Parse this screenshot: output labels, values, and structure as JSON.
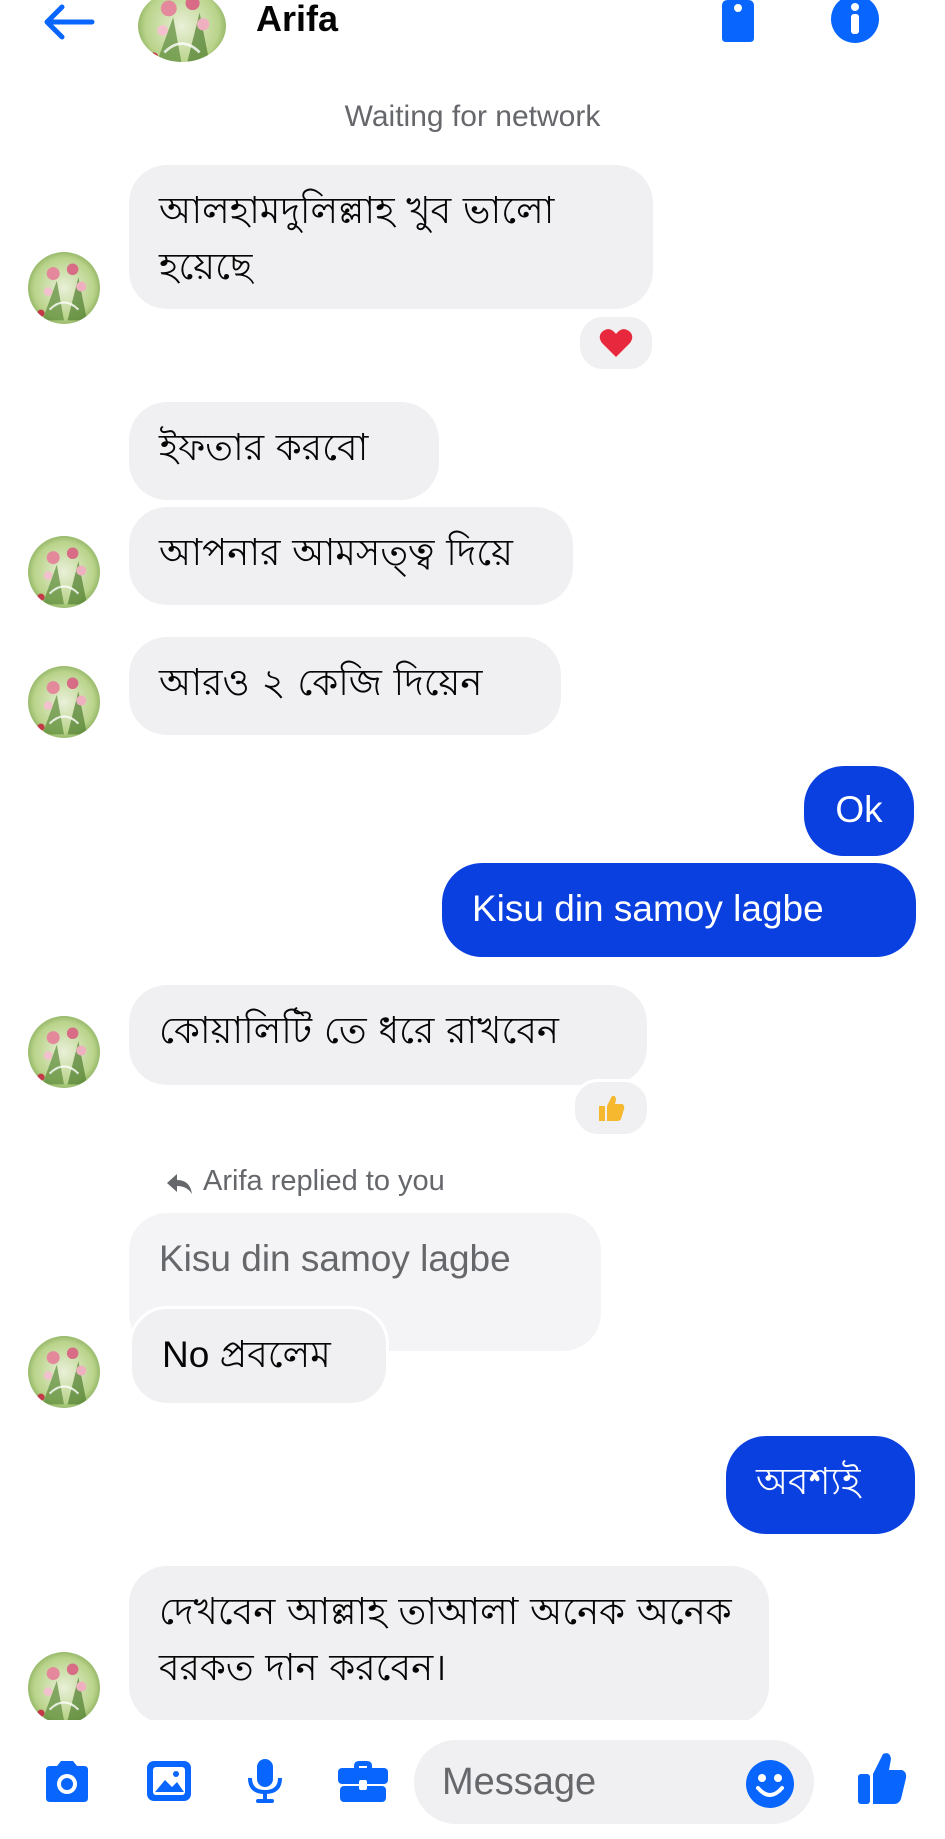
{
  "header": {
    "contact_name": "Arifa",
    "status": "Waiting for network"
  },
  "messages": [
    {
      "text": "আলহামদুলিল্লাহ খুব ভালো হয়েছে",
      "reaction": "heart"
    },
    {
      "text": "ইফতার করবো"
    },
    {
      "text": "আপনার আমসত্ত্ব দিয়ে"
    },
    {
      "text": "আরও ২ কেজি দিয়েন"
    },
    {
      "text": "Ok"
    },
    {
      "text": "Kisu din samoy lagbe"
    },
    {
      "text": "কোয়ালিটি তে ধরে রাখবেন",
      "reaction": "thumbs-up"
    },
    {
      "text": "No প্রবলেম"
    },
    {
      "text": "অবশ্যই"
    },
    {
      "text": "দেখবেন আল্লাহ তাআলা অনেক অনেক বরকত দান করবেন।"
    }
  ],
  "reply": {
    "note": "Arifa replied to you",
    "quoted_text": "Kisu din samoy lagbe"
  },
  "composer": {
    "placeholder": "Message"
  },
  "colors": {
    "accent": "#0a3fe0",
    "icon_blue": "#0866ff",
    "incoming_bubble": "#f0f0f2",
    "secondary_text": "#65676b",
    "heart": "#e8283c",
    "thumbs_up": "#f5b82e"
  },
  "icons": [
    "back-arrow-icon",
    "tag-icon",
    "info-icon",
    "camera-icon",
    "image-icon",
    "microphone-icon",
    "briefcase-icon",
    "emoji-icon",
    "thumbs-up-icon",
    "heart-icon",
    "reply-arrow-icon"
  ]
}
